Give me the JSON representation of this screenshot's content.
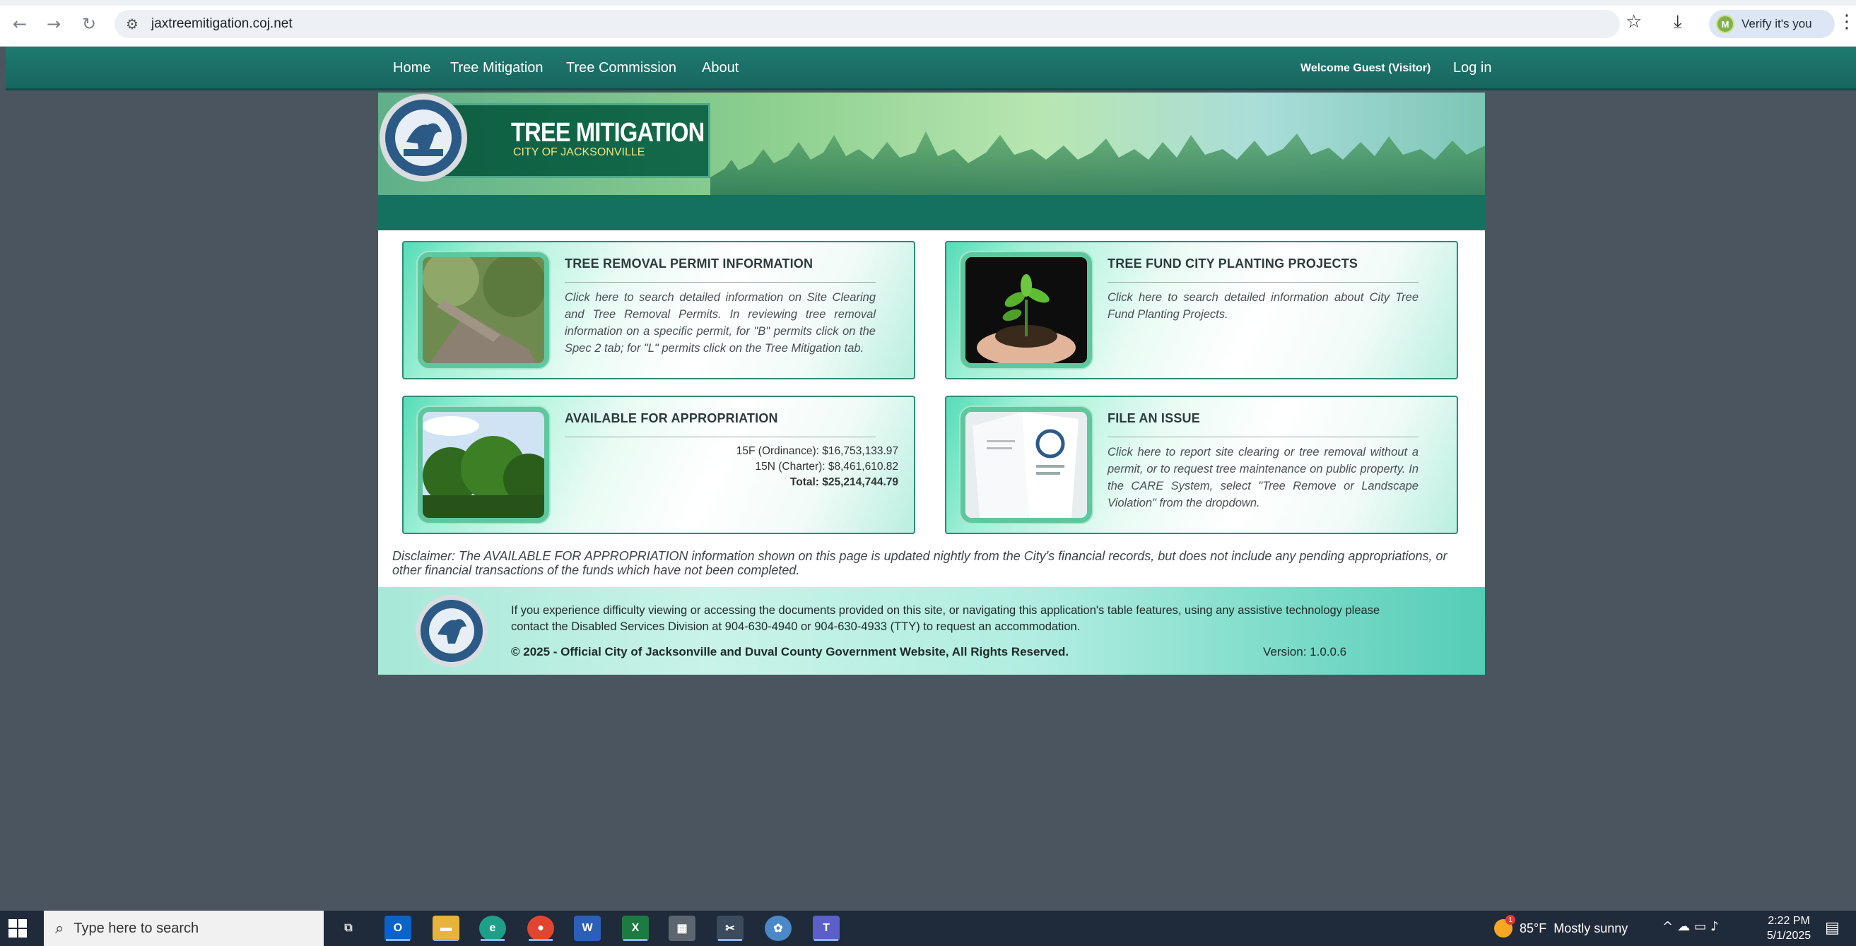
{
  "browser": {
    "back_icon": "arrow-left-icon",
    "forward_icon": "arrow-right-icon",
    "reload_icon": "reload-icon",
    "url": "jaxtreemitigation.coj.net",
    "verify_label": "Verify it's you",
    "verify_avatar_initial": "M"
  },
  "nav": {
    "items": [
      "Home",
      "Tree Mitigation",
      "Tree Commission",
      "About"
    ],
    "welcome": "Welcome Guest (Visitor)",
    "login": "Log in"
  },
  "banner": {
    "title": "TREE MITIGATION",
    "subtitle": "CITY OF JACKSONVILLE"
  },
  "cards": [
    {
      "title": "TREE REMOVAL PERMIT INFORMATION",
      "description": "Click here to search detailed information on Site Clearing and Tree Removal Permits. In reviewing tree removal information on a specific permit, for \"B\" permits click on the Spec 2 tab; for \"L\" permits click on the Tree Mitigation tab."
    },
    {
      "title": "TREE FUND CITY PLANTING PROJECTS",
      "description": "Click here to search detailed information about City Tree Fund Planting Projects."
    },
    {
      "title": "AVAILABLE FOR APPROPRIATION",
      "lines": [
        "15F (Ordinance): $16,753,133.97",
        "15N (Charter): $8,461,610.82"
      ],
      "total": "Total: $25,214,744.79"
    },
    {
      "title": "FILE AN ISSUE",
      "description": "Click here to report site clearing or tree removal without a permit, or to request tree maintenance on public property. In the CARE System, select \"Tree Remove or Landscape Violation\" from the dropdown."
    }
  ],
  "disclaimer": "Disclaimer: The AVAILABLE FOR APPROPRIATION information shown on this page is updated nightly from the City's financial records, but does not include any pending appropriations, or other financial transactions of the funds which have not been completed.",
  "footer": {
    "accessibility": "If you experience difficulty viewing or accessing the documents provided on this site, or navigating this application's table features, using any assistive technology please contact the Disabled Services Division at 904-630-4940 or 904-630-4933 (TTY) to request an accommodation.",
    "copyright": "© 2025 - Official City of Jacksonville and Duval County Government Website, All Rights Reserved.",
    "version": "Version: 1.0.0.6"
  },
  "taskbar": {
    "search_placeholder": "Type here to search",
    "apps": [
      "task-view",
      "outlook",
      "file-explorer",
      "edge",
      "chrome",
      "word",
      "excel",
      "calculator",
      "snipping-tool",
      "settings-app",
      "teams"
    ],
    "weather_temp": "85°F",
    "weather_text": "Mostly sunny",
    "weather_badge": "1",
    "time": "2:22 PM",
    "date": "5/1/2025"
  }
}
